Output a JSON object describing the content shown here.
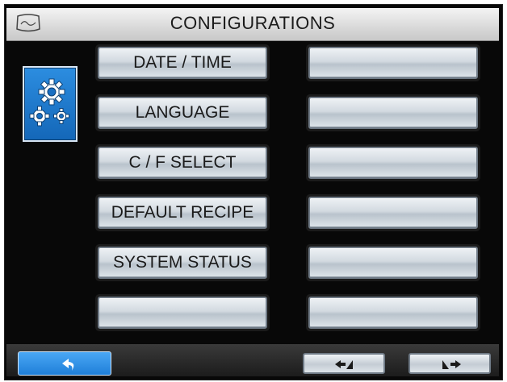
{
  "header": {
    "title": "CONFIGURATIONS"
  },
  "menu": {
    "left": [
      {
        "label": "DATE / TIME"
      },
      {
        "label": "LANGUAGE"
      },
      {
        "label": "C / F SELECT"
      },
      {
        "label": "DEFAULT RECIPE"
      },
      {
        "label": "SYSTEM STATUS"
      },
      {
        "label": ""
      }
    ],
    "right": [
      {
        "label": ""
      },
      {
        "label": ""
      },
      {
        "label": ""
      },
      {
        "label": ""
      },
      {
        "label": ""
      },
      {
        "label": ""
      }
    ]
  },
  "footer": {
    "back_icon": "return-arrow-icon",
    "prev_icon": "page-previous-icon",
    "next_icon": "page-next-icon"
  },
  "colors": {
    "accent_blue": "#1f7fd9",
    "screen_bg": "#080808",
    "button_face": "#d2d9e0"
  }
}
